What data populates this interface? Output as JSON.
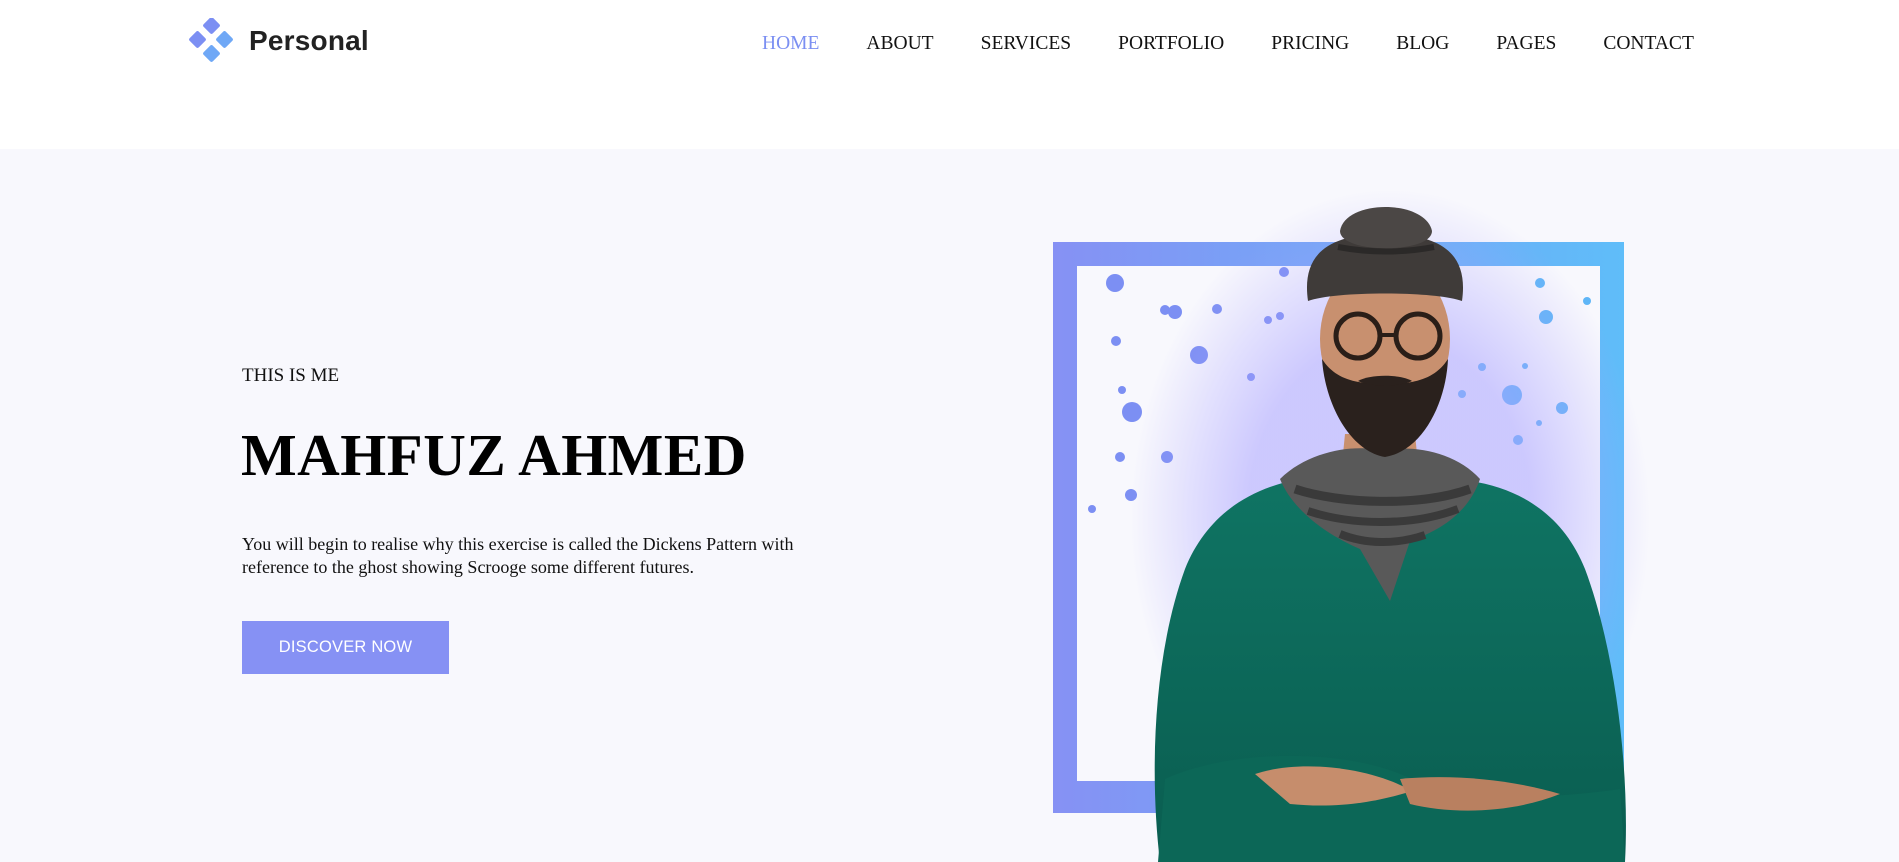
{
  "brand": {
    "name": "Personal",
    "logo_icon": "diamond-cluster-icon",
    "logo_color": "#6f95f2"
  },
  "nav": {
    "items": [
      {
        "label": "HOME",
        "active": true
      },
      {
        "label": "ABOUT",
        "active": false
      },
      {
        "label": "SERVICES",
        "active": false
      },
      {
        "label": "PORTFOLIO",
        "active": false
      },
      {
        "label": "PRICING",
        "active": false
      },
      {
        "label": "BLOG",
        "active": false
      },
      {
        "label": "PAGES",
        "active": false
      },
      {
        "label": "CONTACT",
        "active": false
      }
    ],
    "active_color": "#7b8ff2"
  },
  "hero": {
    "eyebrow": "THIS IS ME",
    "name": "MAHFUZ AHMED",
    "description": "You will begin to realise why this exercise is called the Dickens Pattern with reference to the ghost showing Scrooge some different futures.",
    "cta_label": "DISCOVER NOW",
    "accent_color": "#8691f4",
    "frame_gradient": [
      "#8691f4",
      "#5fbdf9"
    ],
    "portrait": "bearded-man-portrait"
  }
}
